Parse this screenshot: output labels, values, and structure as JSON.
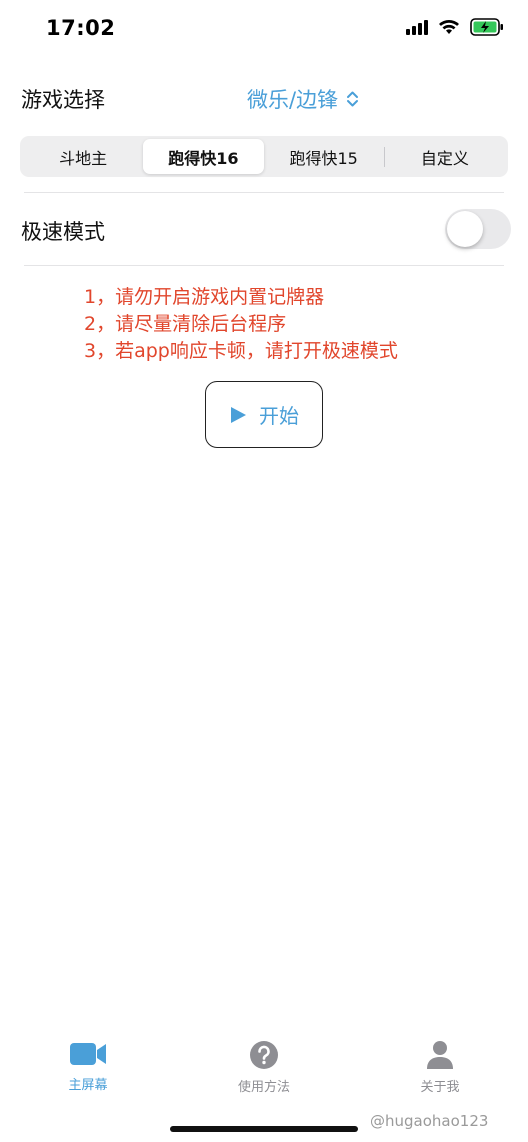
{
  "status": {
    "time": "17:02"
  },
  "game_row": {
    "label": "游戏选择",
    "value": "微乐/边锋"
  },
  "segments": [
    {
      "label": "斗地主",
      "active": false
    },
    {
      "label": "跑得快16",
      "active": true
    },
    {
      "label": "跑得快15",
      "active": false
    },
    {
      "label": "自定义",
      "active": false
    }
  ],
  "fast_mode": {
    "label": "极速模式",
    "enabled": false
  },
  "tips": [
    "1，请勿开启游戏内置记牌器",
    "2，请尽量清除后台程序",
    "3，若app响应卡顿，请打开极速模式"
  ],
  "start_button": {
    "label": "开始"
  },
  "tabs": [
    {
      "label": "主屏幕",
      "icon": "video-camera-icon",
      "active": true
    },
    {
      "label": "使用方法",
      "icon": "question-circle-icon",
      "active": false
    },
    {
      "label": "关于我",
      "icon": "person-icon",
      "active": false
    }
  ],
  "colors": {
    "accent": "#4a9fd8",
    "tip_text": "#e1462c",
    "battery": "#34c759"
  },
  "watermark": "@hugaohao123"
}
